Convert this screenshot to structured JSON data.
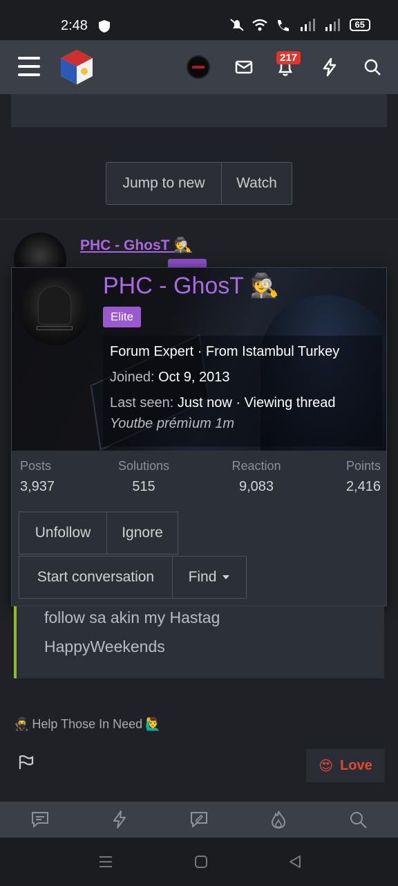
{
  "status_bar": {
    "time": "2:48",
    "battery": "65"
  },
  "nav": {
    "notification_count": "217"
  },
  "thread_buttons": {
    "jump": "Jump to new",
    "watch": "Watch"
  },
  "post": {
    "author": "PHC - GhosT"
  },
  "card": {
    "name": "PHC - GhosT",
    "rank": "Elite",
    "title_line": "Forum Expert · From Istambul Turkey",
    "joined_label": "Joined:",
    "joined_value": "Oct 9, 2013",
    "last_seen_label": "Last seen:",
    "last_seen_value": "Just now · Viewing thread",
    "custom_status": "Youtbe prémìum 1m",
    "stats": [
      {
        "label": "Posts",
        "value": "3,937"
      },
      {
        "label": "Solutions",
        "value": "515"
      },
      {
        "label": "Reaction",
        "value": "9,083"
      },
      {
        "label": "Points",
        "value": "2,416"
      }
    ],
    "buttons": {
      "unfollow": "Unfollow",
      "ignore": "Ignore",
      "start_conversation": "Start conversation",
      "find": "Find"
    }
  },
  "post_body": {
    "line1": "follow sa akin my Hastag",
    "line2": "HappyWeekends"
  },
  "signature": "Help Those In Need",
  "reaction": {
    "label": "Love"
  },
  "colors": {
    "username": "#a86ce0",
    "elite_badge": "#9b59d0",
    "quote_border": "#8bbd28",
    "love": "#e04a2f",
    "badge": "#e0362e"
  }
}
